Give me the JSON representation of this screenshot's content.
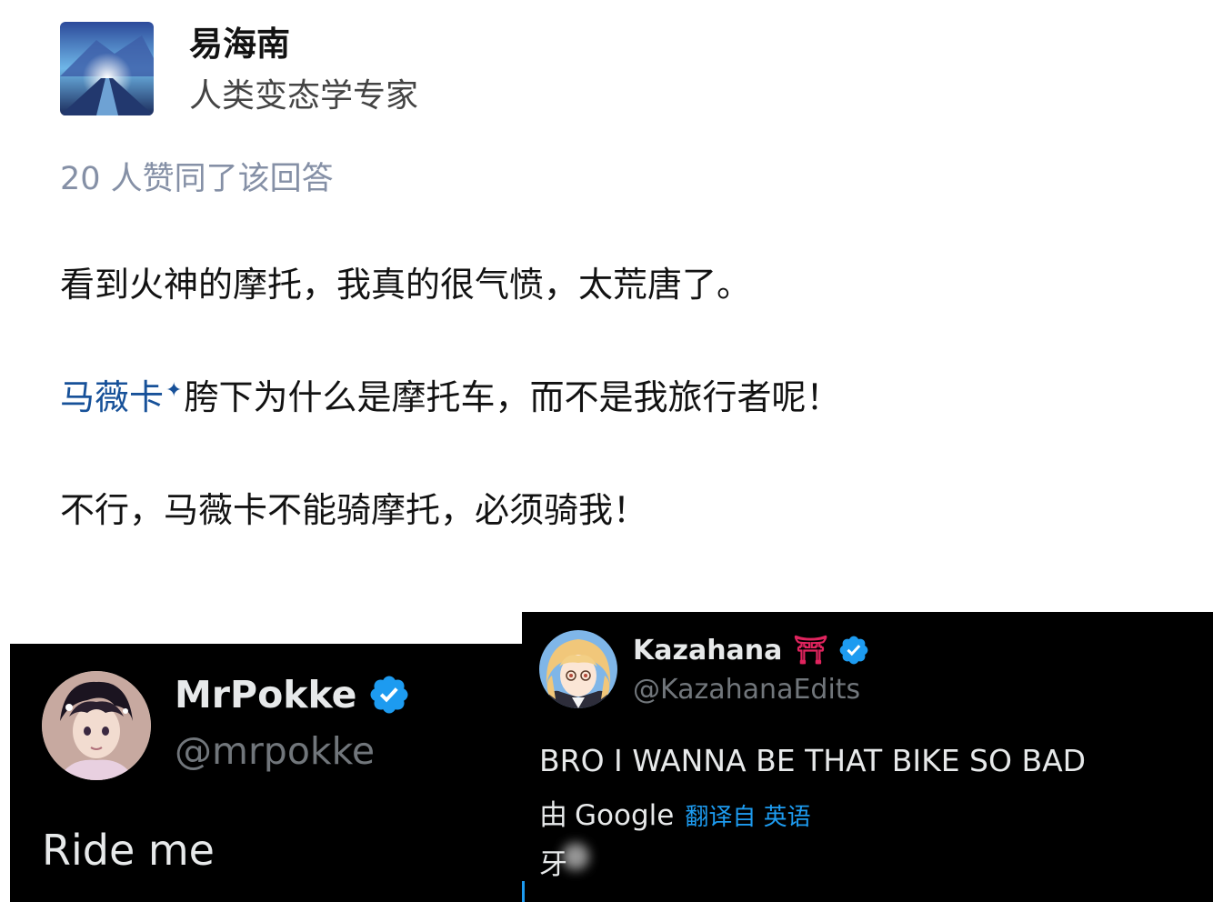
{
  "zhihu": {
    "author_name": "易海南",
    "author_bio": "人类变态学专家",
    "votes_text": "20 人赞同了该回答",
    "paragraph_1": "看到火神的摩托，我真的很气愤，太荒唐了。",
    "paragraph_2_link": "马薇卡",
    "paragraph_2_rest": "胯下为什么是摩托车，而不是我旅行者呢！",
    "paragraph_3": "不行，马薇卡不能骑摩托，必须骑我！",
    "link_color": "#175199"
  },
  "tweet_left": {
    "display_name": "MrPokke",
    "handle": "@mrpokke",
    "text": "Ride me",
    "verified": true,
    "avatar_icon": "anime-avatar"
  },
  "tweet_right": {
    "display_name": "Kazahana",
    "name_emoji": "⛩",
    "handle": "@KazahanaEdits",
    "text": "BRO I WANNA BE THAT BIKE SO BAD",
    "translated_by": "由",
    "translator": "Google",
    "translate_link": "翻译自 英语",
    "translated_text_partial": "牙",
    "verified": true,
    "avatar_icon": "anime-avatar",
    "accent_color": "#1d9bf0"
  }
}
